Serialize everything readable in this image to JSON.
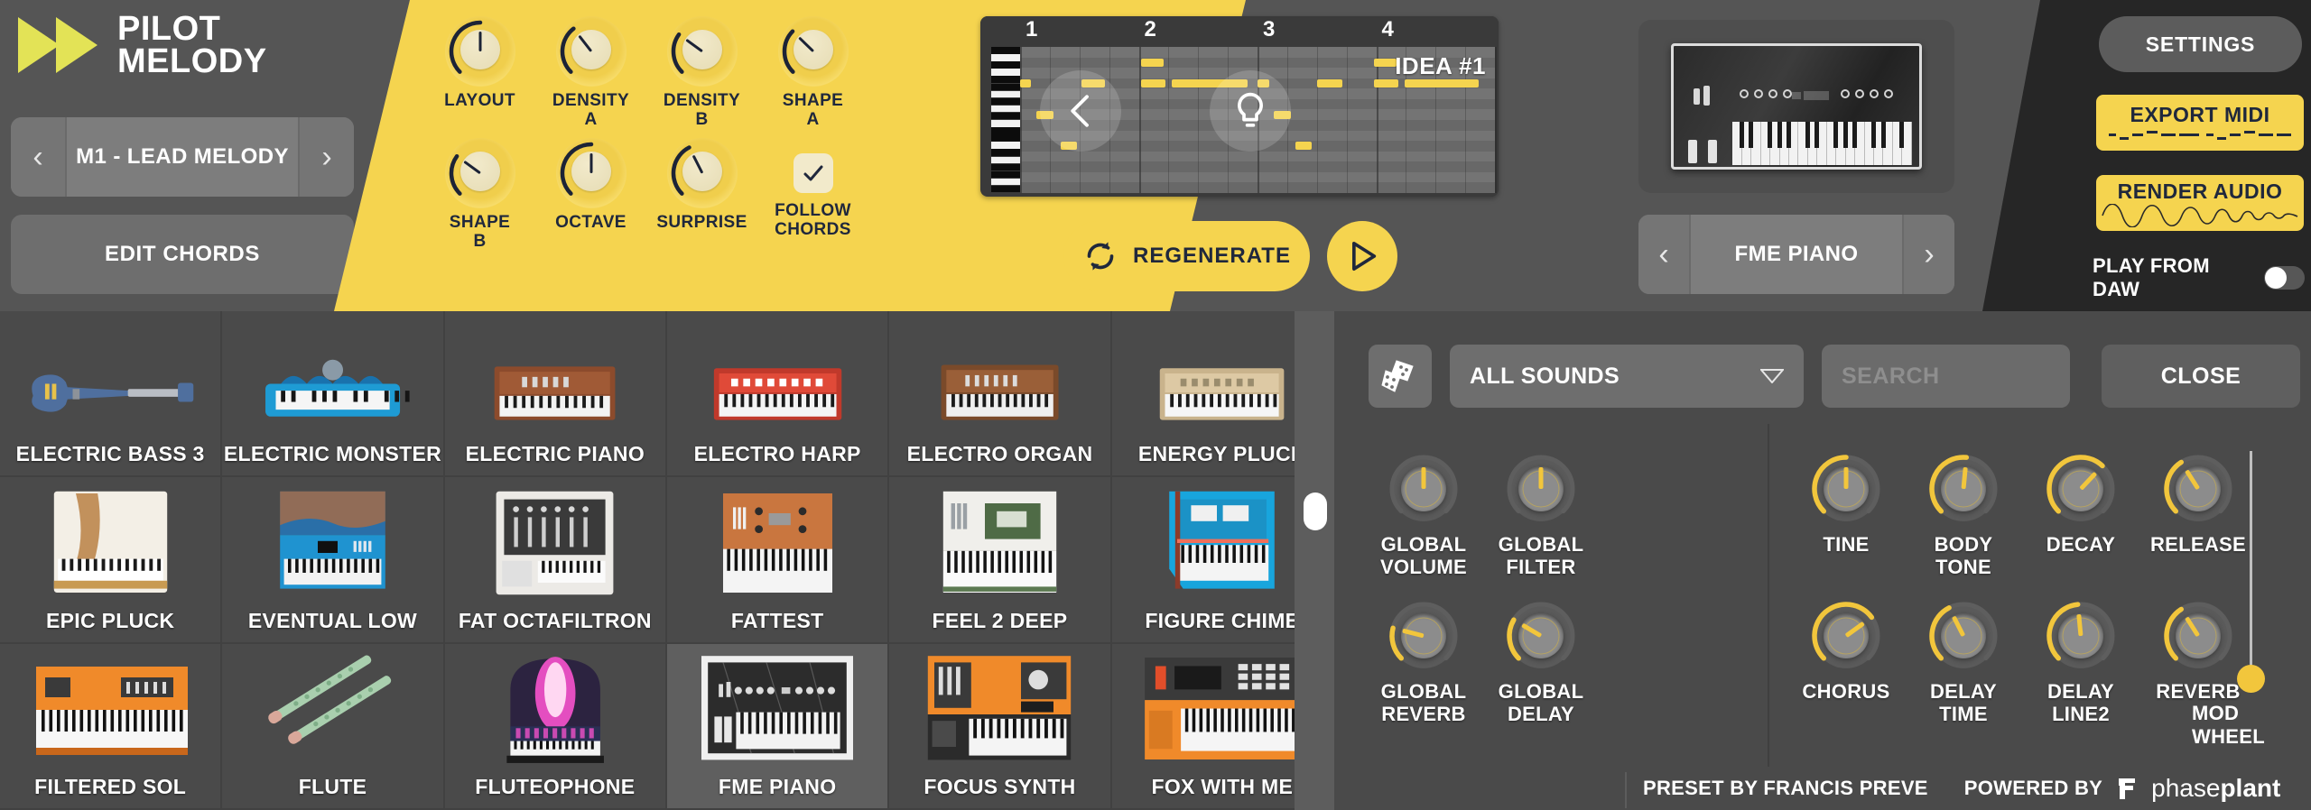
{
  "app": {
    "brand_line1": "PILOT",
    "brand_line2": "MELODY",
    "accent_yellow": "#f5d44f",
    "dark_navy": "#20283c",
    "panel_gray": "#4a4a4a"
  },
  "melody": {
    "selector_value": "M1 - LEAD MELODY",
    "prev_arrow": "‹",
    "next_arrow": "›",
    "edit_chords_label": "EDIT CHORDS"
  },
  "generator_knobs": [
    {
      "label": "LAYOUT",
      "value": 0.5
    },
    {
      "label": "DENSITY A",
      "value": 0.36
    },
    {
      "label": "DENSITY B",
      "value": 0.3
    },
    {
      "label": "SHAPE A",
      "value": 0.33
    },
    {
      "label": "SHAPE B",
      "value": 0.3
    },
    {
      "label": "OCTAVE",
      "value": 0.5
    },
    {
      "label": "SURPRISE",
      "value": 0.4
    }
  ],
  "follow_chords": {
    "label": "FOLLOW CHORDS",
    "checked": true
  },
  "piano_roll": {
    "idea_label": "IDEA #1",
    "bar_numbers": [
      "1",
      "2",
      "3",
      "4"
    ],
    "prev_button": "previous-idea",
    "idea_button": "idea-lightbulb",
    "notes": [
      {
        "lane": 1,
        "start": 0.255,
        "length": 0.048
      },
      {
        "lane": 1,
        "start": 0.745,
        "length": 0.048
      },
      {
        "lane": 3,
        "start": 0.0,
        "length": 0.022
      },
      {
        "lane": 3,
        "start": 0.13,
        "length": 0.048
      },
      {
        "lane": 3,
        "start": 0.255,
        "length": 0.052
      },
      {
        "lane": 3,
        "start": 0.32,
        "length": 0.16
      },
      {
        "lane": 3,
        "start": 0.5,
        "length": 0.024
      },
      {
        "lane": 3,
        "start": 0.625,
        "length": 0.053
      },
      {
        "lane": 3,
        "start": 0.745,
        "length": 0.052
      },
      {
        "lane": 3,
        "start": 0.81,
        "length": 0.155
      },
      {
        "lane": 6,
        "start": 0.035,
        "length": 0.035
      },
      {
        "lane": 6,
        "start": 0.535,
        "length": 0.035
      },
      {
        "lane": 9,
        "start": 0.085,
        "length": 0.035
      },
      {
        "lane": 9,
        "start": 0.58,
        "length": 0.035
      }
    ]
  },
  "transport": {
    "regenerate_label": "REGENERATE",
    "play_label": "play"
  },
  "instrument": {
    "selector_value": "FME PIANO",
    "prev_arrow": "‹",
    "next_arrow": "›"
  },
  "top_right": {
    "settings_label": "SETTINGS",
    "export_midi_label": "EXPORT MIDI",
    "render_audio_label": "RENDER AUDIO",
    "play_from_daw_label": "PLAY FROM DAW",
    "play_from_daw_on": false
  },
  "browser_toolbar": {
    "dice_label": "randomize",
    "category_value": "ALL SOUNDS",
    "search_placeholder": "SEARCH",
    "close_label": "CLOSE"
  },
  "browser_grid": {
    "selected": "FME PIANO",
    "tiles": [
      {
        "name": "ELECTRIC BASS 3",
        "art": "guitar-blue"
      },
      {
        "name": "ELECTRIC MONSTER",
        "art": "keytar-blue"
      },
      {
        "name": "ELECTRIC PIANO",
        "art": "keys-brown"
      },
      {
        "name": "ELECTRO HARP",
        "art": "keys-red"
      },
      {
        "name": "ELECTRO ORGAN",
        "art": "organ-brown"
      },
      {
        "name": "ENERGY PLUCK",
        "art": "keys-tan"
      },
      {
        "name": "EPIC PLUCK",
        "art": "keys-marble"
      },
      {
        "name": "EVENTUAL LOW",
        "art": "keys-bluetop"
      },
      {
        "name": "FAT OCTAFILTRON",
        "art": "keys-white-rack"
      },
      {
        "name": "FATTEST",
        "art": "keys-orange-panel"
      },
      {
        "name": "FEEL 2 DEEP",
        "art": "keys-green-panel"
      },
      {
        "name": "FIGURE CHIME",
        "art": "keys-cyan"
      },
      {
        "name": "FILTERED SOL",
        "art": "keys-orange"
      },
      {
        "name": "FLUTE",
        "art": "flutes"
      },
      {
        "name": "FLUTEOPHONE",
        "art": "organ-magenta"
      },
      {
        "name": "FME PIANO",
        "art": "keys-mono"
      },
      {
        "name": "FOCUS SYNTH",
        "art": "keys-orange2"
      },
      {
        "name": "FOX WITH ME",
        "art": "keys-orange3"
      }
    ]
  },
  "global_knobs": [
    {
      "label": "GLOBAL VOLUME",
      "value": 0.5,
      "arc": false
    },
    {
      "label": "GLOBAL FILTER",
      "value": 0.5,
      "arc": false
    },
    {
      "label": "GLOBAL REVERB",
      "value": 0.22,
      "arc": true
    },
    {
      "label": "GLOBAL DELAY",
      "value": 0.28,
      "arc": true
    }
  ],
  "preset_knobs": [
    {
      "label": "TINE",
      "value": 0.5,
      "arc": true
    },
    {
      "label": "BODY TONE",
      "value": 0.52,
      "arc": true
    },
    {
      "label": "DECAY",
      "value": 0.66,
      "arc": true
    },
    {
      "label": "RELEASE",
      "value": 0.38,
      "arc": true
    },
    {
      "label": "CHORUS",
      "value": 0.7,
      "arc": true
    },
    {
      "label": "DELAY TIME",
      "value": 0.4,
      "arc": true
    },
    {
      "label": "DELAY LINE2",
      "value": 0.48,
      "arc": true
    },
    {
      "label": "REVERB",
      "value": 0.38,
      "arc": true
    }
  ],
  "mod_wheel": {
    "label": "MOD WHEEL",
    "value": 0.0
  },
  "footer": {
    "preset_by": "PRESET BY FRANCIS PREVE",
    "powered_by": "POWERED BY",
    "brand_light": "phase",
    "brand_bold": "plant"
  }
}
